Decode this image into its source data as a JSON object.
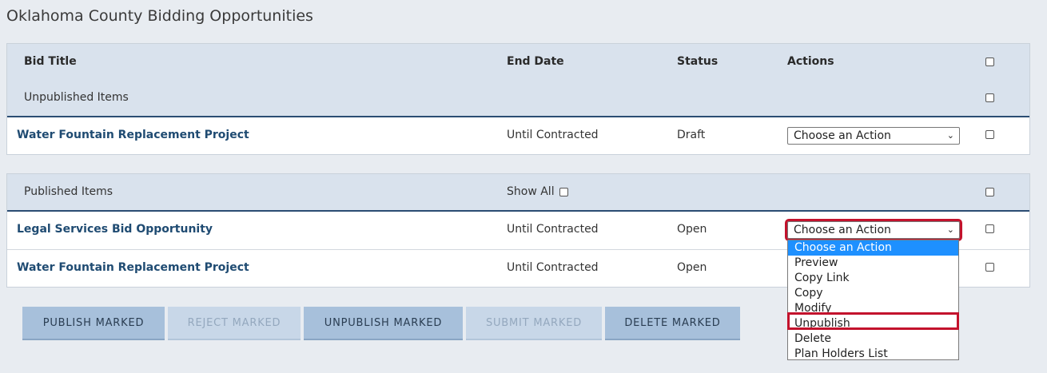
{
  "page": {
    "title": "Oklahoma County Bidding Opportunities"
  },
  "table": {
    "headers": {
      "bid_title": "Bid Title",
      "end_date": "End Date",
      "status": "Status",
      "actions": "Actions"
    },
    "unpublished": {
      "label": "Unpublished Items",
      "rows": [
        {
          "title": "Water Fountain Replacement Project",
          "end_date": "Until Contracted",
          "status": "Draft",
          "action": "Choose an Action"
        }
      ]
    },
    "published": {
      "label": "Published Items",
      "show_all_label": "Show All",
      "rows": [
        {
          "title": "Legal Services Bid Opportunity",
          "end_date": "Until Contracted",
          "status": "Open",
          "action": "Choose an Action"
        },
        {
          "title": "Water Fountain Replacement Project",
          "end_date": "Until Contracted",
          "status": "Open",
          "action": ""
        }
      ]
    }
  },
  "dropdown": {
    "options": [
      "Choose an Action",
      "Preview",
      "Copy Link",
      "Copy",
      "Modify",
      "Unpublish",
      "Delete",
      "Plan Holders List"
    ],
    "selected_index": 0,
    "highlighted_option": "Unpublish"
  },
  "buttons": {
    "publish": "PUBLISH MARKED",
    "reject": "REJECT MARKED",
    "unpublish": "UNPUBLISH MARKED",
    "submit": "SUBMIT MARKED",
    "delete": "DELETE MARKED"
  },
  "colors": {
    "accent": "#1f4b72",
    "highlight": "#c3122c",
    "header_bg": "#d9e2ed",
    "button_bg": "#a7c0db"
  }
}
